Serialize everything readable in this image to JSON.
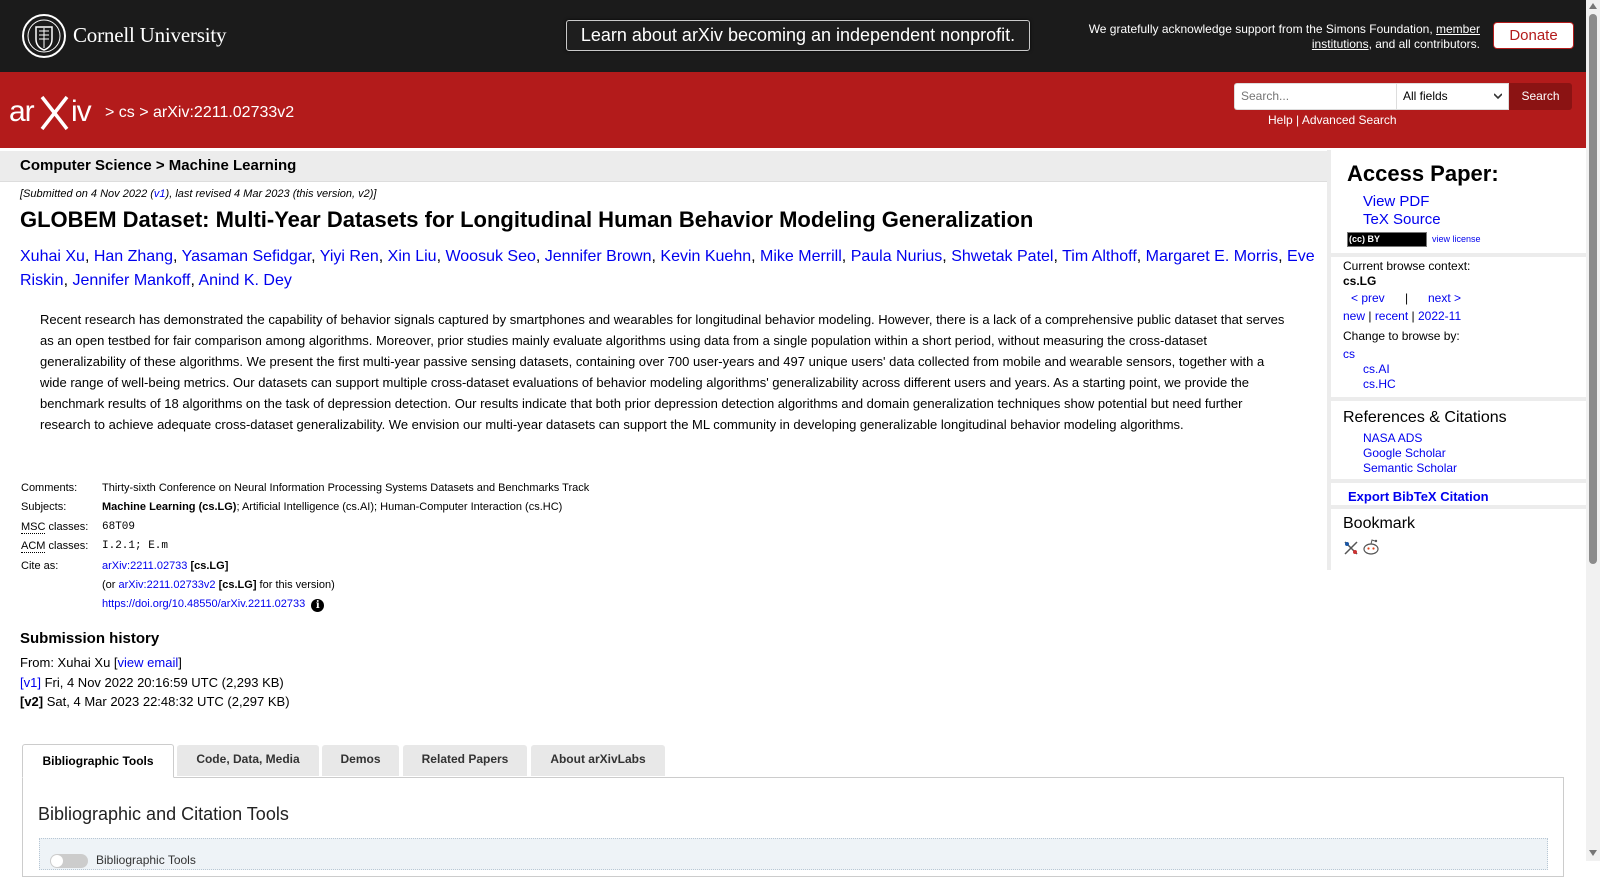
{
  "topbar": {
    "university": "Cornell University",
    "banner": "Learn about arXiv becoming an independent nonprofit.",
    "support_prefix": "We gratefully acknowledge support from the Simons Foundation, ",
    "support_link": "member institutions",
    "support_suffix": ", and all contributors.",
    "donate": "Donate"
  },
  "header": {
    "breadcrumb_sep1": " > ",
    "breadcrumb_cat": "cs",
    "breadcrumb_sep2": " > ",
    "breadcrumb_id": "arXiv:2211.02733v2",
    "search_placeholder": "Search...",
    "search_field": "All fields",
    "search_button": "Search",
    "help": "Help",
    "pipe": " | ",
    "advanced_search": "Advanced Search"
  },
  "paper": {
    "subject_header": "Computer Science > Machine Learning",
    "dateline_pre": "[Submitted on 4 Nov 2022 (",
    "dateline_v1": "v1",
    "dateline_post": "), last revised 4 Mar 2023 (this version, v2)]",
    "title": "GLOBEM Dataset: Multi-Year Datasets for Longitudinal Human Behavior Modeling Generalization",
    "authors": [
      "Xuhai Xu",
      "Han Zhang",
      "Yasaman Sefidgar",
      "Yiyi Ren",
      "Xin Liu",
      "Woosuk Seo",
      "Jennifer Brown",
      "Kevin Kuehn",
      "Mike Merrill",
      "Paula Nurius",
      "Shwetak Patel",
      "Tim Althoff",
      "Margaret E. Morris",
      "Eve Riskin",
      "Jennifer Mankoff",
      "Anind K. Dey"
    ],
    "abstract": "Recent research has demonstrated the capability of behavior signals captured by smartphones and wearables for longitudinal behavior modeling. However, there is a lack of a comprehensive public dataset that serves as an open testbed for fair comparison among algorithms. Moreover, prior studies mainly evaluate algorithms using data from a single population within a short period, without measuring the cross-dataset generalizability of these algorithms. We present the first multi-year passive sensing datasets, containing over 700 user-years and 497 unique users' data collected from mobile and wearable sensors, together with a wide range of well-being metrics. Our datasets can support multiple cross-dataset evaluations of behavior modeling algorithms' generalizability across different users and years. As a starting point, we provide the benchmark results of 18 algorithms on the task of depression detection. Our results indicate that both prior depression detection algorithms and domain generalization techniques show potential but need further research to achieve adequate cross-dataset generalizability. We envision our multi-year datasets can support the ML community in developing generalizable longitudinal behavior modeling algorithms."
  },
  "meta": {
    "comments_label": "Comments:",
    "comments": "Thirty-sixth Conference on Neural Information Processing Systems Datasets and Benchmarks Track",
    "subjects_label": "Subjects:",
    "subjects_primary": "Machine Learning (cs.LG)",
    "subjects_rest": "; Artificial Intelligence (cs.AI); Human-Computer Interaction (cs.HC)",
    "msc_abbr": "MSC",
    "acm_abbr": "ACM",
    "classes_word": " classes:",
    "msc_value": "68T09",
    "acm_value": "I.2.1; E.m",
    "cite_label": "Cite as:",
    "cite_id": "arXiv:2211.02733",
    "cite_cat": " [cs.LG]",
    "cite_or": "(or ",
    "cite_version": "arXiv:2211.02733v2",
    "cite_version_cat": " [cs.LG]",
    "cite_for": " for this version)",
    "doi": "https://doi.org/10.48550/arXiv.2211.02733",
    "info_glyph": "i"
  },
  "history": {
    "title": "Submission history",
    "from_pre": "From: Xuhai Xu [",
    "view_email": "view email",
    "from_post": "]",
    "v1_link": "[v1]",
    "v1_text": " Fri, 4 Nov 2022 20:16:59 UTC (2,293 KB)",
    "v2_label": "[v2]",
    "v2_text": " Sat, 4 Mar 2023 22:48:32 UTC (2,297 KB)"
  },
  "tabs": {
    "items": [
      "Bibliographic Tools",
      "Code, Data, Media",
      "Demos",
      "Related Papers",
      "About arXivLabs"
    ],
    "active": "Bibliographic Tools",
    "panel_title": "Bibliographic and Citation Tools",
    "toggle_label": "Bibliographic Tools"
  },
  "sidebar": {
    "access_title": "Access Paper:",
    "view_pdf": "View PDF",
    "tex_source": "TeX Source",
    "license_badge": "(cc) BY",
    "view_license": "view license",
    "context_label": "Current browse context:",
    "context_value": "cs.LG",
    "prev": "< prev",
    "pipe": "|",
    "next": "next >",
    "new": "new",
    "recent": "recent",
    "month": "2022-11",
    "sep": " | ",
    "change_label": "Change to browse by:",
    "browse_cs": "cs",
    "browse_ai": "cs.AI",
    "browse_hc": "cs.HC",
    "refs_title": "References & Citations",
    "nasa_ads": "NASA ADS",
    "google_scholar": "Google Scholar",
    "semantic_scholar": "Semantic Scholar",
    "export_bib": "Export BibTeX Citation",
    "bookmark_title": "Bookmark"
  },
  "colors": {
    "arxiv_red": "#b31b1b",
    "topbar_black": "#1b1b1b",
    "link_blue": "#0000ee"
  }
}
